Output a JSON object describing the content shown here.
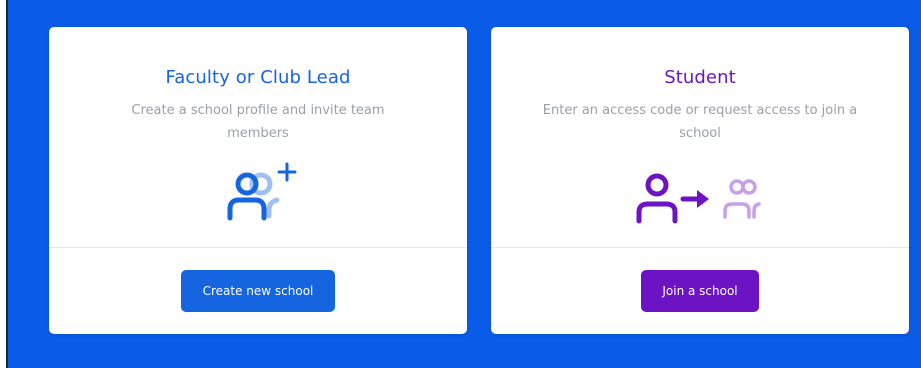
{
  "cards": [
    {
      "title": "Faculty or Club Lead",
      "description": "Create a school profile and invite team members",
      "icon": "add-team-members-icon",
      "button_label": "Create new school",
      "accent": "#1565e0"
    },
    {
      "title": "Student",
      "description": "Enter an access code or request access to join a school",
      "icon": "join-school-icon",
      "button_label": "Join a school",
      "accent": "#6c14c4"
    }
  ],
  "colors": {
    "background": "#0a5ce8",
    "card": "#ffffff",
    "description": "#9aa0a8",
    "divider": "#e6e8ec",
    "icon_secondary_blue": "#9fc0f5",
    "icon_secondary_purple": "#c6a0e8"
  }
}
